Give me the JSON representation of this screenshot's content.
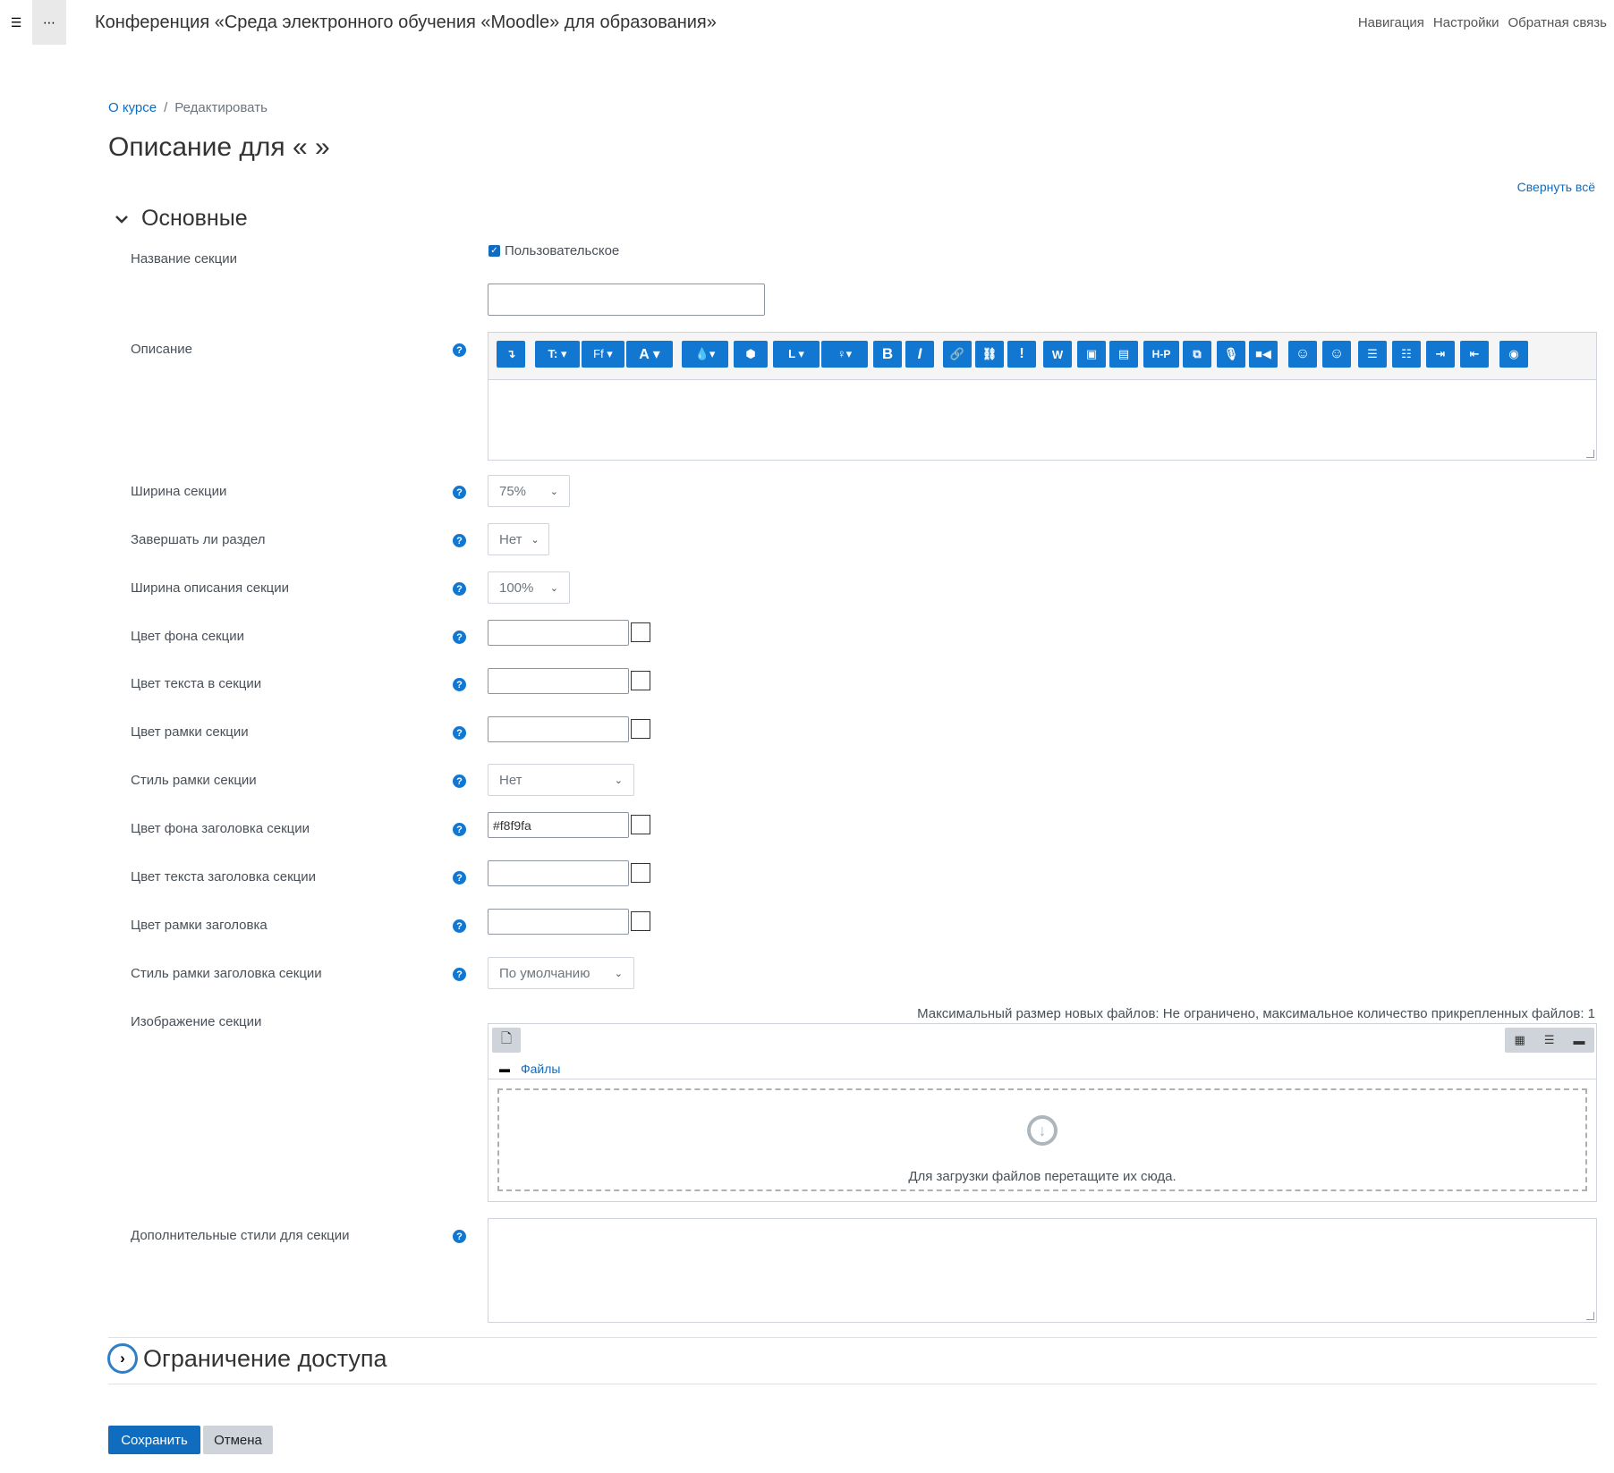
{
  "topbar": {
    "site_title": "Конференция «Среда электронного обучения «Moodle» для образования»",
    "links": [
      "Навигация",
      "Настройки",
      "Обратная связь"
    ]
  },
  "breadcrumb": {
    "items": [
      "О курсе",
      "Редактировать"
    ],
    "separator": "/"
  },
  "page_title": "Описание для « »",
  "collapse_all": "Свернуть всё",
  "section_general": "Основные",
  "section_restrict": "Ограничение доступа",
  "form": {
    "section_name_label": "Название секции",
    "custom_checkbox_label": "Пользовательское",
    "section_name_value": "",
    "description_label": "Описание",
    "width_label": "Ширина секции",
    "width_value": "75%",
    "finish_label": "Завершать ли раздел",
    "finish_value": "Нет",
    "desc_width_label": "Ширина описания секции",
    "desc_width_value": "100%",
    "bg_color_label": "Цвет фона секции",
    "bg_color_value": "",
    "text_color_label": "Цвет текста в секции",
    "text_color_value": "",
    "border_color_label": "Цвет рамки секции",
    "border_color_value": "",
    "border_style_label": "Стиль рамки секции",
    "border_style_value": "Нет",
    "header_bg_label": "Цвет фона заголовка секции",
    "header_bg_value": "#f8f9fa",
    "header_text_label": "Цвет текста заголовка секции",
    "header_text_value": "",
    "header_border_label": "Цвет рамки заголовка",
    "header_border_value": "",
    "header_border_style_label": "Стиль рамки заголовка секции",
    "header_border_style_value": "По умолчанию",
    "image_label": "Изображение секции",
    "max_info": "Максимальный размер новых файлов: Не ограничено, максимальное количество прикрепленных файлов: 1",
    "files_path": "Файлы",
    "drop_text": "Для загрузки файлов перетащите их сюда.",
    "extra_styles_label": "Дополнительные стили для секции"
  },
  "buttons": {
    "save": "Сохранить",
    "cancel": "Отмена"
  },
  "toolbar_icons": [
    "collapse",
    "font-size",
    "font-family",
    "font-color",
    "background-color",
    "html",
    "special-char",
    "idea",
    "bold",
    "italic",
    "link",
    "unlink",
    "alert",
    "word-import",
    "image",
    "media",
    "h5p",
    "paste",
    "record-audio",
    "record-video",
    "emoji",
    "emoticon",
    "unordered-list",
    "ordered-list",
    "indent",
    "outdent",
    "accessibility"
  ],
  "colors": {
    "accent": "#0f6cbf",
    "button_blue": "#1177d1"
  }
}
